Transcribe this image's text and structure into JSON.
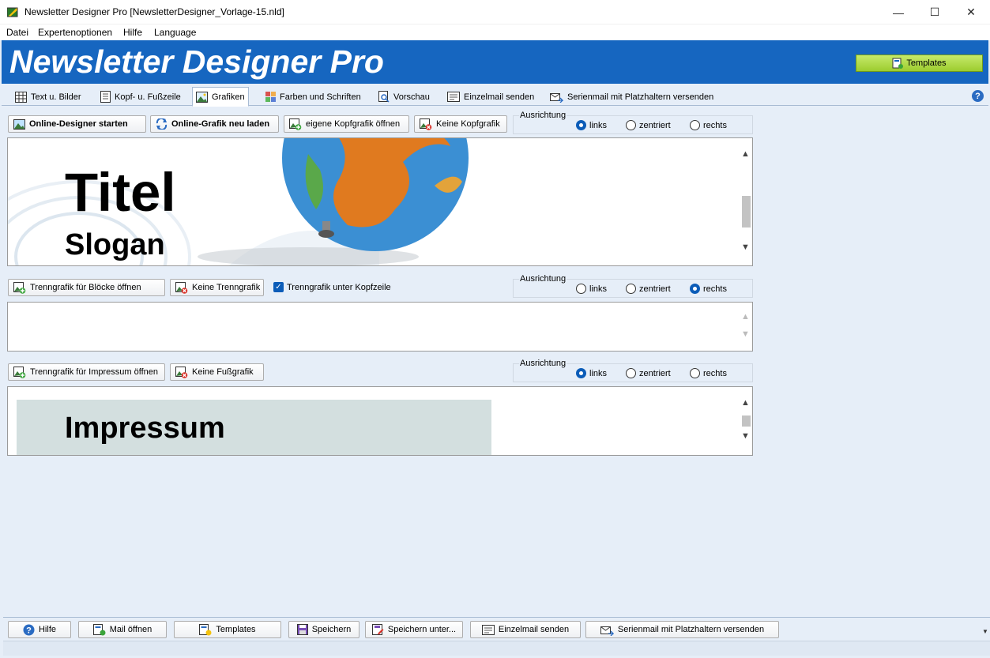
{
  "window": {
    "title": "Newsletter Designer Pro [NewsletterDesigner_Vorlage-15.nld]",
    "minimize": "—",
    "maximize": "☐",
    "close": "✕"
  },
  "menu": [
    "Datei",
    "Expertenoptionen",
    "Hilfe",
    "Language"
  ],
  "banner": {
    "logo": "Newsletter Designer Pro",
    "templates_button": "Templates"
  },
  "tabs": [
    {
      "label": "Text u. Bilder"
    },
    {
      "label": "Kopf- u. Fußzeile"
    },
    {
      "label": "Grafiken",
      "active": true
    },
    {
      "label": "Farben und Schriften"
    },
    {
      "label": "Vorschau"
    },
    {
      "label": "Einzelmail senden"
    },
    {
      "label": "Serienmail mit Platzhaltern versenden"
    }
  ],
  "help_glyph": "?",
  "header_section": {
    "buttons": [
      "Online-Designer starten",
      "Online-Grafik neu laden",
      "eigene Kopfgrafik öffnen",
      "Keine Kopfgrafik"
    ],
    "alignment": {
      "label": "Ausrichtung",
      "options": [
        "links",
        "zentriert",
        "rechts"
      ],
      "selected": "links"
    },
    "preview": {
      "title": "Titel",
      "slogan": "Slogan"
    }
  },
  "separator_section": {
    "buttons": [
      "Trenngrafik für Blöcke öffnen",
      "Keine Trenngrafik"
    ],
    "checkbox": {
      "label": "Trenngrafik unter Kopfzeile",
      "checked": true
    },
    "alignment": {
      "label": "Ausrichtung",
      "options": [
        "links",
        "zentriert",
        "rechts"
      ],
      "selected": "rechts"
    }
  },
  "footer_section": {
    "buttons": [
      "Trenngrafik für Impressum öffnen",
      "Keine Fußgrafik"
    ],
    "alignment": {
      "label": "Ausrichtung",
      "options": [
        "links",
        "zentriert",
        "rechts"
      ],
      "selected": "links"
    },
    "preview": {
      "title": "Impressum"
    }
  },
  "bottom_buttons": [
    "Hilfe",
    "Mail öffnen",
    "Templates",
    "Speichern",
    "Speichern unter...",
    "Einzelmail senden",
    "Serienmail mit Platzhaltern versenden"
  ],
  "colors": {
    "banner": "#1666c0",
    "templates_button": "#a8d640",
    "radio_selected": "#0b5cb8",
    "background": "#e6eef8"
  }
}
